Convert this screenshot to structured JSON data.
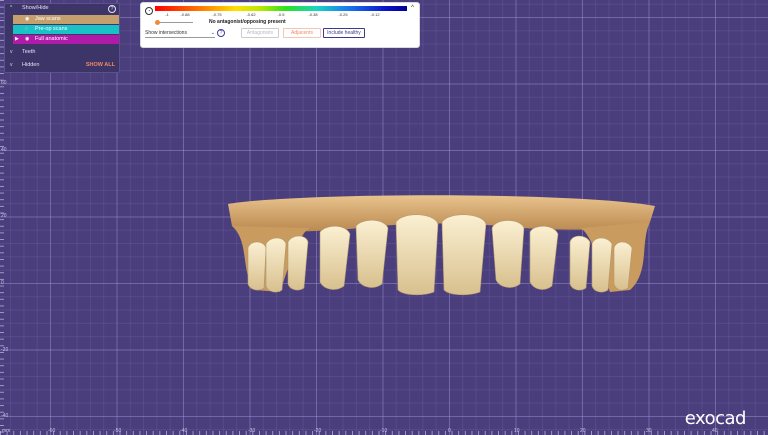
{
  "panel": {
    "header": "Show/Hide",
    "scans": [
      {
        "label": "Jaw scans",
        "icon": "eye-icon"
      },
      {
        "label": "Pre-op scans",
        "icon": "eye-hidden-icon"
      },
      {
        "label": "Full anatomic",
        "icon": "eye-icon"
      }
    ],
    "teeth": "Teeth",
    "hidden": "Hidden",
    "show_all": "SHOW ALL",
    "colors": {
      "jaw": "#c69f6e",
      "preop": "#19c2c4",
      "full": "#b01aa8"
    }
  },
  "toolbar": {
    "scale_values": [
      "-1",
      "-0.88",
      "-0.75",
      "-0.62",
      "-0.5",
      "-0.38",
      "-0.25",
      "-0.12"
    ],
    "status": "No antagonist/opposing present",
    "select_value": "Show intersections",
    "buttons": {
      "antagonists": "Antagonists",
      "adjacents": "Adjacents",
      "include_healthy": "Include healthy"
    }
  },
  "axis": {
    "left_labels": [
      "60",
      "40",
      "20",
      "0",
      "-20",
      "-40"
    ],
    "bottom_labels": [
      "-60",
      "-50",
      "-40",
      "-30",
      "-20",
      "-10",
      "0",
      "10",
      "20",
      "30",
      "40",
      "50",
      "60"
    ],
    "unit": "mm"
  },
  "logo": "exocad"
}
